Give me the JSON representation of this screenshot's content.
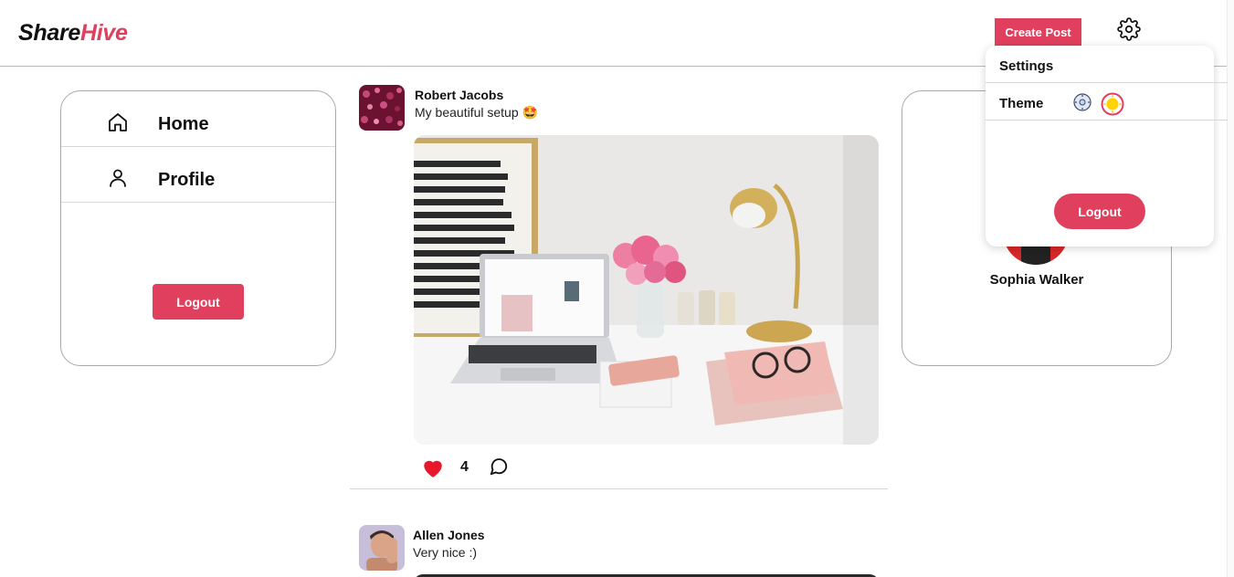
{
  "header": {
    "logo_part1": "Share",
    "logo_part2": "Hive",
    "create_post_label": "Create Post",
    "settings_icon": "gear-icon"
  },
  "sidebar": {
    "items": [
      {
        "label": "Home",
        "icon": "home-icon"
      },
      {
        "label": "Profile",
        "icon": "user-icon"
      }
    ],
    "logout_label": "Logout"
  },
  "feed": {
    "posts": [
      {
        "user": "Robert Jacobs",
        "caption": "My beautiful setup 🤩",
        "likes": "4",
        "liked": true
      },
      {
        "user": "Allen Jones",
        "caption": "Very nice :)"
      }
    ]
  },
  "profile_card": {
    "name": "Sophia Walker"
  },
  "settings_menu": {
    "title": "Settings",
    "theme_label": "Theme",
    "theme_options": [
      "dark-theme-icon",
      "light-theme-icon"
    ],
    "selected_theme": "light",
    "logout_label": "Logout"
  },
  "colors": {
    "accent": "#e0405e",
    "like": "#e8172a"
  }
}
